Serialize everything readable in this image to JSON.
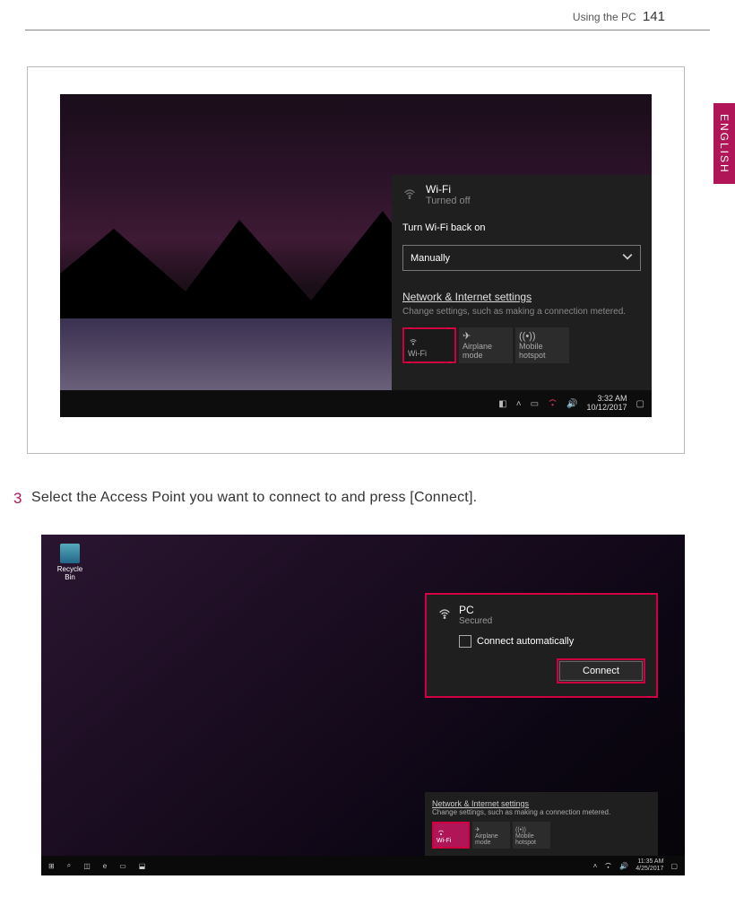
{
  "header": {
    "section": "Using the PC",
    "page": "141"
  },
  "lang_tab": "ENGLISH",
  "screenshot1": {
    "flyout": {
      "title": "Wi-Fi",
      "status": "Turned off",
      "back_on_label": "Turn Wi-Fi back on",
      "select_value": "Manually",
      "settings_link": "Network & Internet settings",
      "settings_sub": "Change settings, such as making a connection metered.",
      "tiles": {
        "wifi": "Wi-Fi",
        "airplane": "Airplane mode",
        "hotspot": "Mobile hotspot"
      }
    },
    "taskbar": {
      "time": "3:32 AM",
      "date": "10/12/2017"
    }
  },
  "step": {
    "num": "3",
    "text": "Select the Access Point you want to connect to and press [Connect]."
  },
  "screenshot2": {
    "recycle": "Recycle Bin",
    "panel": {
      "name": "PC",
      "secured": "Secured",
      "auto": "Connect automatically",
      "connect": "Connect"
    },
    "settings": {
      "link": "Network & Internet settings",
      "sub": "Change settings, such as making a connection metered.",
      "tiles": {
        "wifi": "Wi-Fi",
        "airplane": "Airplane mode",
        "hotspot": "Mobile hotspot"
      }
    },
    "taskbar": {
      "time": "11:35 AM",
      "date": "4/25/2017"
    }
  }
}
